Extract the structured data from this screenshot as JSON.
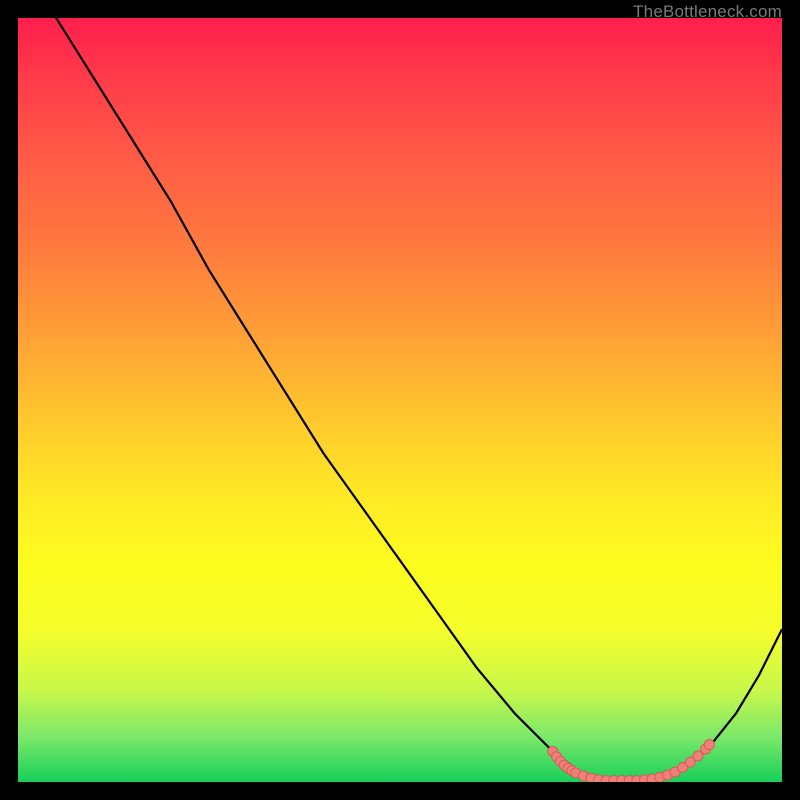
{
  "attribution": "TheBottleneck.com",
  "colors": {
    "frame": "#000000",
    "curve_stroke": "#000000",
    "marker_fill": "#ef7f79",
    "marker_stroke": "#d65d57",
    "attribution_text": "#787878"
  },
  "chart_data": {
    "type": "line",
    "title": "",
    "xlabel": "",
    "ylabel": "",
    "xlim": [
      0,
      100
    ],
    "ylim": [
      0,
      100
    ],
    "curve": {
      "name": "bottleneck-curve",
      "x": [
        0,
        5,
        10,
        15,
        20,
        25,
        30,
        35,
        40,
        45,
        50,
        55,
        60,
        65,
        70,
        74,
        78,
        82,
        86,
        90,
        94,
        97,
        100
      ],
      "y": [
        108,
        100,
        92,
        84,
        76,
        67,
        59,
        51,
        43,
        36,
        29,
        22,
        15,
        9,
        4,
        1,
        0,
        0,
        1,
        4,
        9,
        14,
        20
      ]
    },
    "markers": {
      "name": "bottleneck-sweet-spot",
      "points": [
        {
          "x": 70,
          "y": 4.0
        },
        {
          "x": 70.5,
          "y": 3.3
        },
        {
          "x": 71,
          "y": 2.7
        },
        {
          "x": 71.5,
          "y": 2.2
        },
        {
          "x": 72,
          "y": 1.8
        },
        {
          "x": 72.5,
          "y": 1.5
        },
        {
          "x": 73,
          "y": 1.2
        },
        {
          "x": 74,
          "y": 0.8
        },
        {
          "x": 75,
          "y": 0.5
        },
        {
          "x": 76,
          "y": 0.3
        },
        {
          "x": 77,
          "y": 0.2
        },
        {
          "x": 78,
          "y": 0.2
        },
        {
          "x": 79,
          "y": 0.2
        },
        {
          "x": 80,
          "y": 0.2
        },
        {
          "x": 81,
          "y": 0.2
        },
        {
          "x": 82,
          "y": 0.3
        },
        {
          "x": 83,
          "y": 0.4
        },
        {
          "x": 84,
          "y": 0.6
        },
        {
          "x": 85,
          "y": 0.9
        },
        {
          "x": 86,
          "y": 1.3
        },
        {
          "x": 87,
          "y": 1.9
        },
        {
          "x": 88,
          "y": 2.6
        },
        {
          "x": 89,
          "y": 3.4
        },
        {
          "x": 90,
          "y": 4.3
        },
        {
          "x": 90.5,
          "y": 4.9
        }
      ]
    }
  }
}
